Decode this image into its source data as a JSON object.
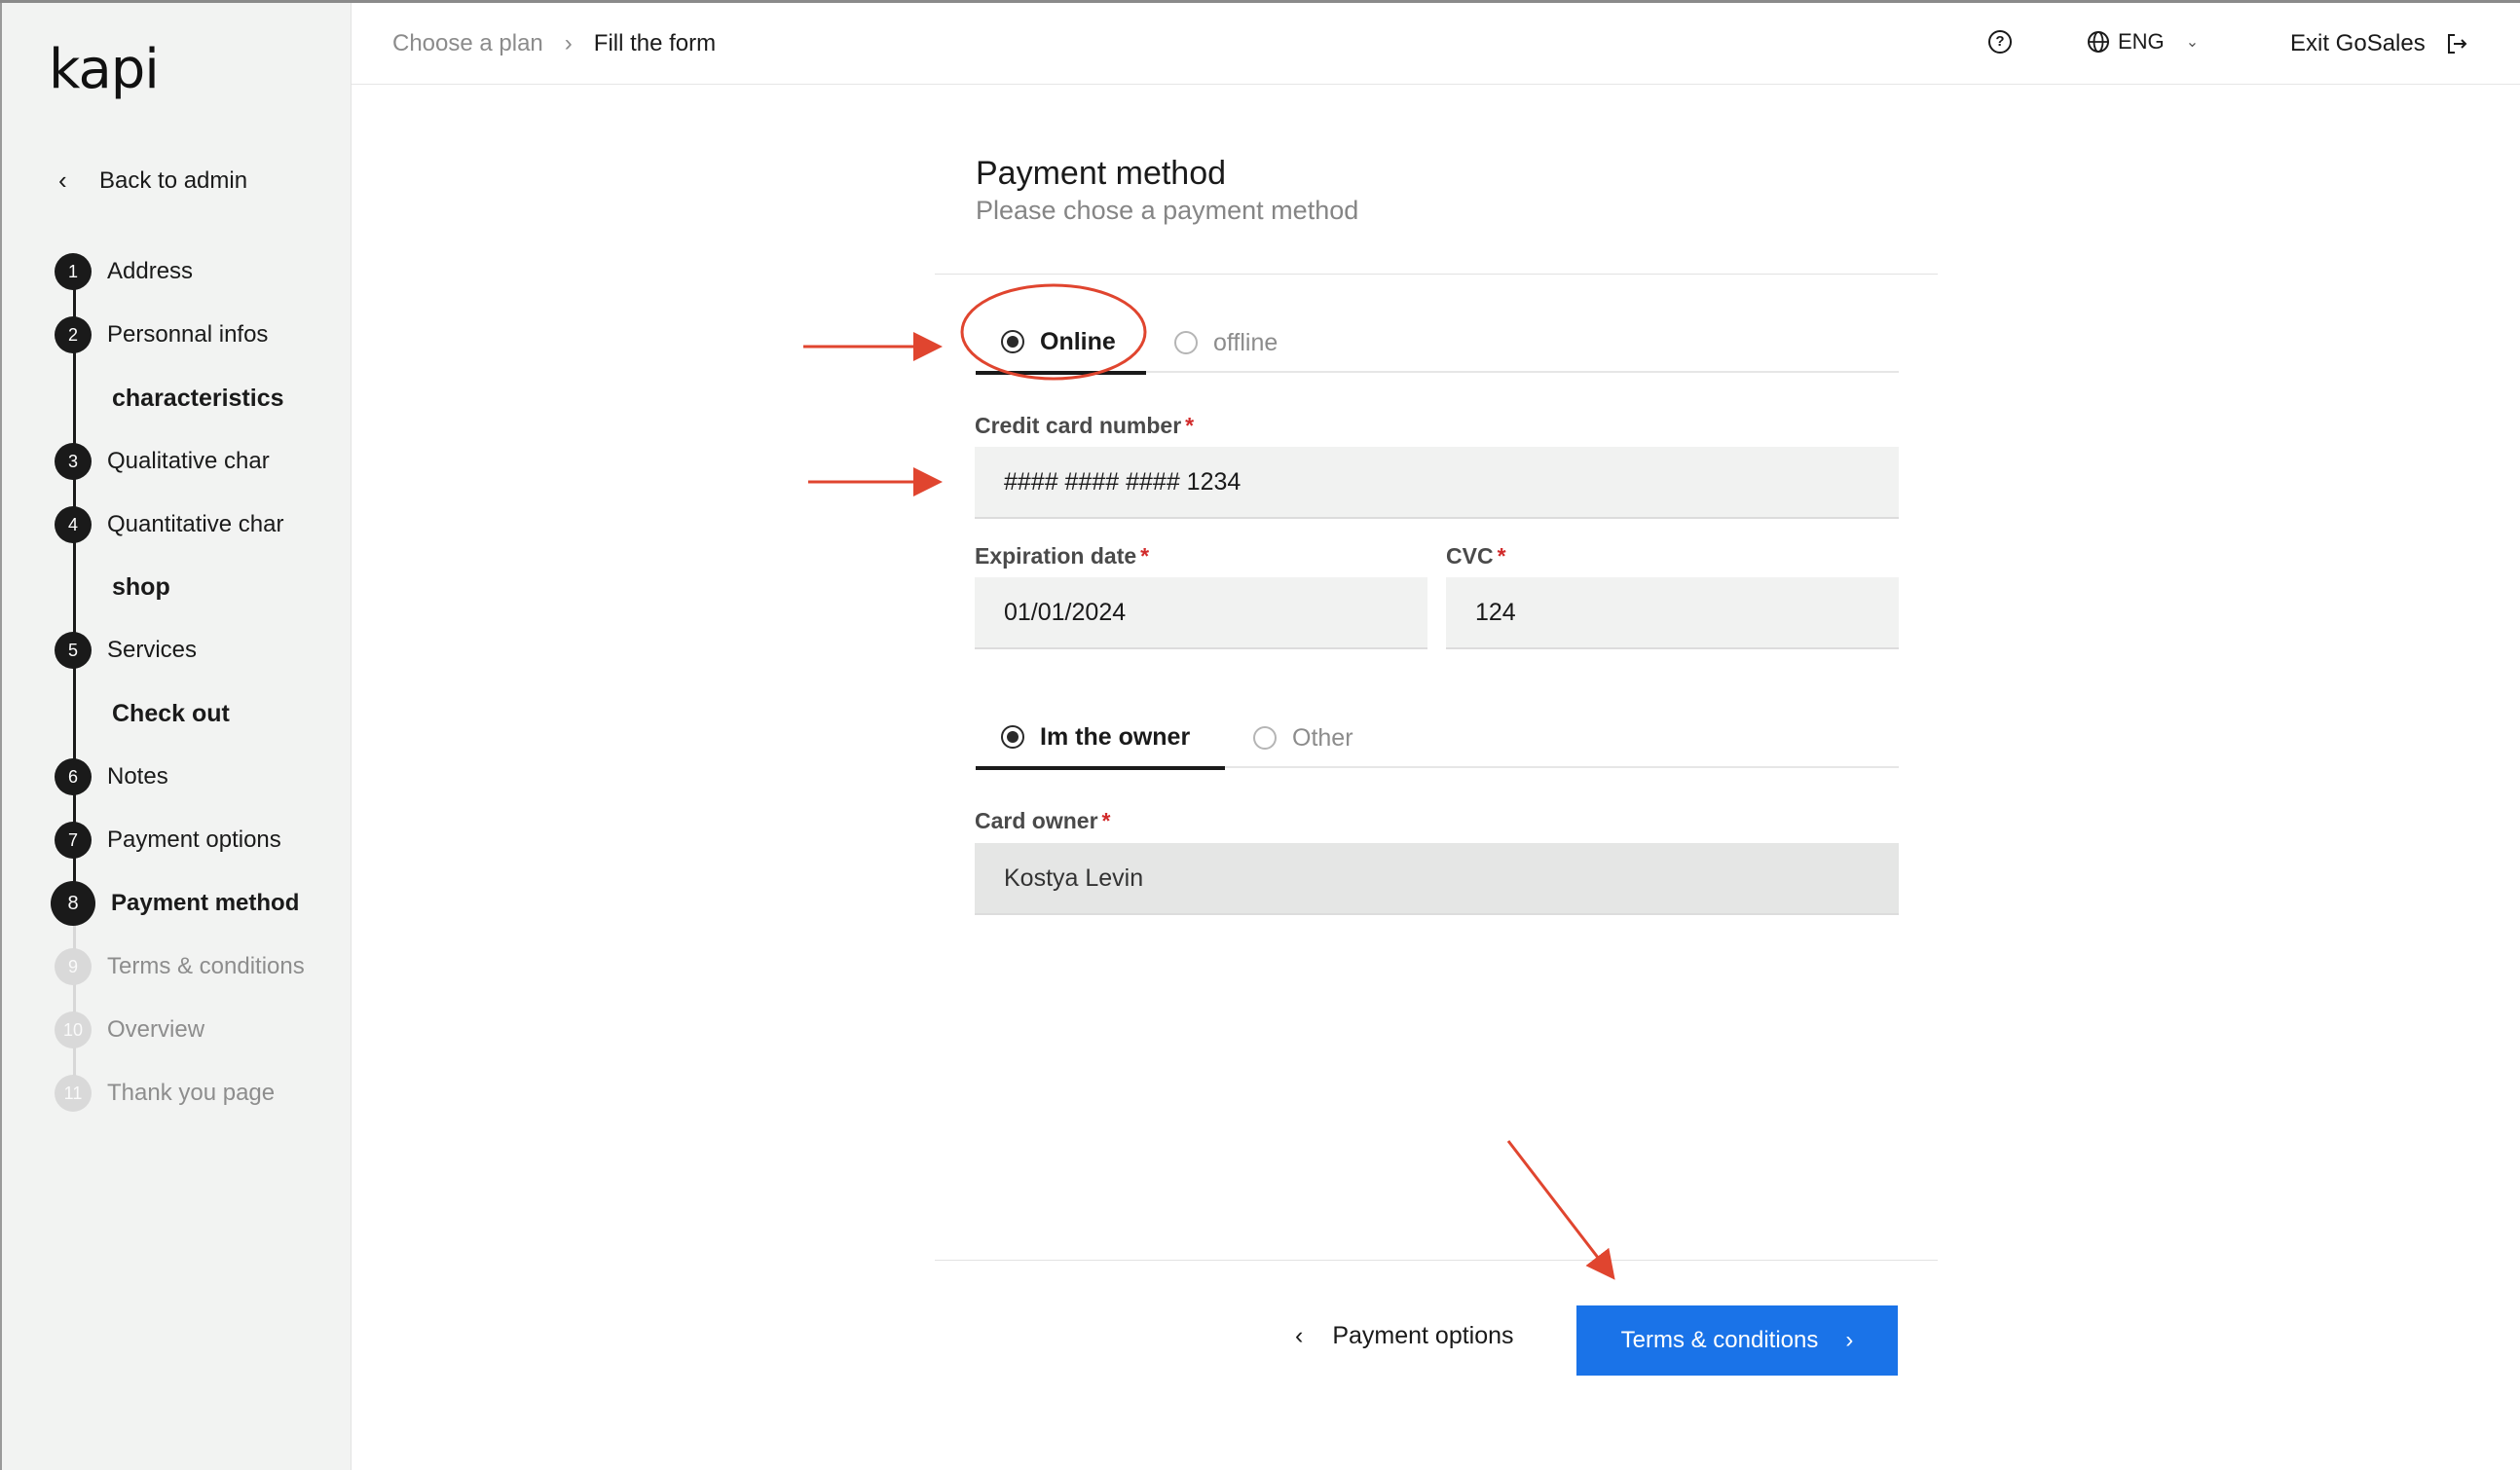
{
  "sidebar": {
    "logo": "kapi",
    "back_label": "Back to admin",
    "steps": [
      {
        "num": "1",
        "label": "Address"
      },
      {
        "num": "2",
        "label": "Personnal infos"
      },
      {
        "num": "3",
        "label": "Qualitative char"
      },
      {
        "num": "4",
        "label": "Quantitative char"
      },
      {
        "num": "5",
        "label": "Services"
      },
      {
        "num": "6",
        "label": "Notes"
      },
      {
        "num": "7",
        "label": "Payment options"
      },
      {
        "num": "8",
        "label": "Payment method"
      },
      {
        "num": "9",
        "label": "Terms & conditions"
      },
      {
        "num": "10",
        "label": "Overview"
      },
      {
        "num": "11",
        "label": "Thank you page"
      }
    ],
    "sections": [
      "characteristics",
      "shop",
      "Check out"
    ]
  },
  "topbar": {
    "breadcrumb": [
      "Choose a plan",
      "Fill the form"
    ],
    "language": "ENG",
    "exit_label": "Exit GoSales"
  },
  "form": {
    "title": "Payment method",
    "subtitle": "Please chose a payment method",
    "payment_tabs": [
      "Online",
      "offline"
    ],
    "card_number_label": "Credit card number",
    "card_number_value": "#### #### #### 1234",
    "expiration_label": "Expiration date",
    "expiration_value": "01/01/2024",
    "cvc_label": "CVC",
    "cvc_value": "124",
    "owner_tabs": [
      "Im the owner",
      "Other"
    ],
    "card_owner_label": "Card owner",
    "card_owner_value": "Kostya Levin",
    "required_mark": "*"
  },
  "footer": {
    "back_label": "Payment options",
    "next_label": "Terms & conditions"
  },
  "colors": {
    "primary_button": "#1a73e8",
    "annotation": "#e0452f",
    "required": "#d12a2a"
  }
}
